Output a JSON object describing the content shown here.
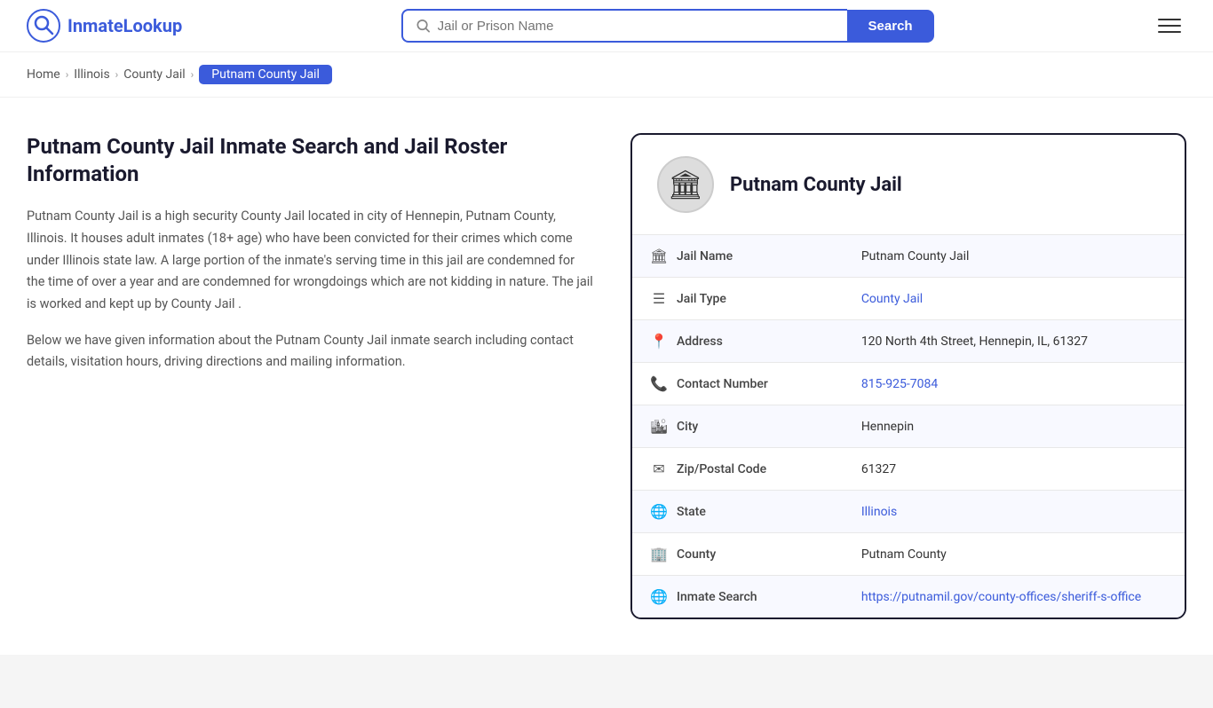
{
  "header": {
    "logo_brand": "InmateLookup",
    "logo_brand_prefix": "Inmate",
    "logo_brand_suffix": "Lookup",
    "search_placeholder": "Jail or Prison Name",
    "search_button_label": "Search"
  },
  "breadcrumb": {
    "items": [
      {
        "label": "Home",
        "href": "#"
      },
      {
        "label": "Illinois",
        "href": "#"
      },
      {
        "label": "County Jail",
        "href": "#"
      },
      {
        "label": "Putnam County Jail",
        "current": true
      }
    ]
  },
  "main": {
    "page_title": "Putnam County Jail Inmate Search and Jail Roster Information",
    "description_1": "Putnam County Jail is a high security County Jail located in city of Hennepin, Putnam County, Illinois. It houses adult inmates (18+ age) who have been convicted for their crimes which come under Illinois state law. A large portion of the inmate's serving time in this jail are condemned for the time of over a year and are condemned for wrongdoings which are not kidding in nature. The jail is worked and kept up by County Jail .",
    "description_2": "Below we have given information about the Putnam County Jail inmate search including contact details, visitation hours, driving directions and mailing information."
  },
  "info_card": {
    "title": "Putnam County Jail",
    "rows": [
      {
        "icon": "🏛",
        "label": "Jail Name",
        "value": "Putnam County Jail",
        "link": null
      },
      {
        "icon": "☰",
        "label": "Jail Type",
        "value": "County Jail",
        "link": "#"
      },
      {
        "icon": "📍",
        "label": "Address",
        "value": "120 North 4th Street, Hennepin, IL, 61327",
        "link": null
      },
      {
        "icon": "📞",
        "label": "Contact Number",
        "value": "815-925-7084",
        "link": "tel:815-925-7084"
      },
      {
        "icon": "🏙",
        "label": "City",
        "value": "Hennepin",
        "link": null
      },
      {
        "icon": "✉",
        "label": "Zip/Postal Code",
        "value": "61327",
        "link": null
      },
      {
        "icon": "🌐",
        "label": "State",
        "value": "Illinois",
        "link": "#"
      },
      {
        "icon": "🏢",
        "label": "County",
        "value": "Putnam County",
        "link": null
      },
      {
        "icon": "🌐",
        "label": "Inmate Search",
        "value": "https://putnamil.gov/county-offices/sheriff-s-office",
        "link": "https://putnamil.gov/county-offices/sheriff-s-office"
      }
    ]
  },
  "colors": {
    "accent": "#3b5bdb",
    "dark": "#1a1a2e"
  }
}
